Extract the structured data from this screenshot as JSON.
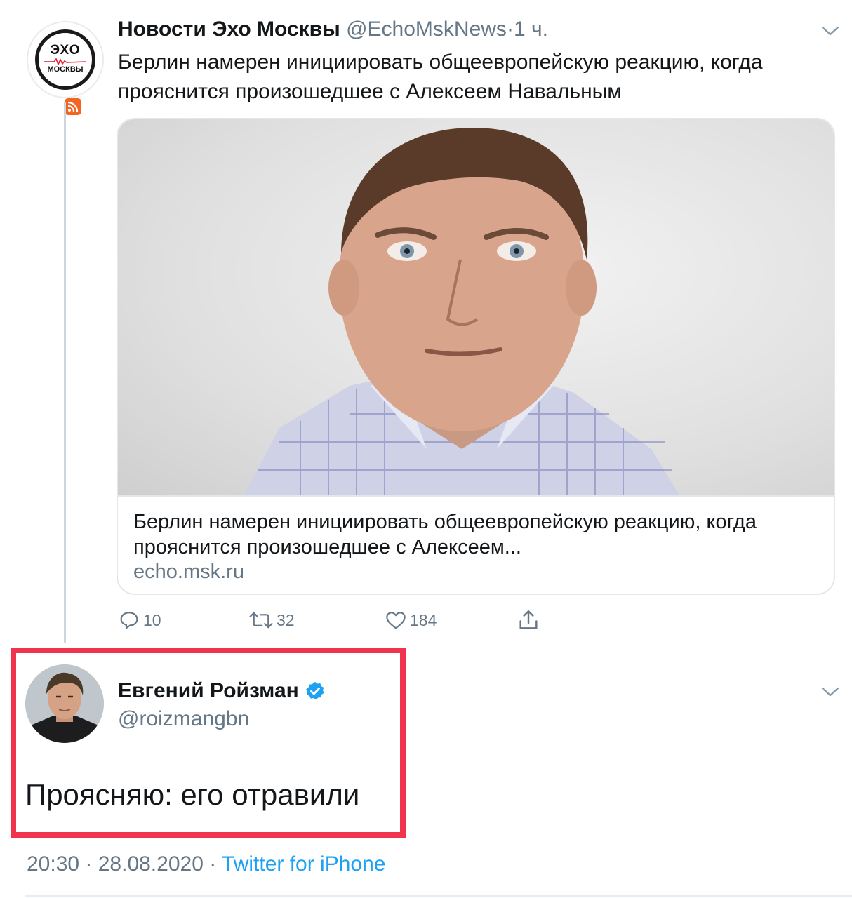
{
  "tweet": {
    "author_name": "Новости Эхо Москвы",
    "author_handle": "@EchoMskNews",
    "separator": "·",
    "time": "1 ч.",
    "text": "Берлин намерен инициировать общеевропейскую реакцию, когда прояснится произошедшее с Алексеем Навальным",
    "avatar_logo_top": "ЭХО",
    "avatar_logo_bottom": "МОСКВЫ",
    "card": {
      "title": "Берлин намерен инициировать общеевропейскую реакцию, когда прояснится произошедшее с Алексеем...",
      "domain": "echo.msk.ru"
    },
    "actions": {
      "replies": "10",
      "retweets": "32",
      "likes": "184"
    },
    "icons": [
      "chevron-down-icon",
      "reply-icon",
      "retweet-icon",
      "like-icon",
      "share-icon",
      "rss-icon"
    ]
  },
  "reply": {
    "author_name": "Евгений Ройзман",
    "author_handle": "@roizmangbn",
    "text": "Проясняю: его отравили",
    "timestamp": "20:30 · 28.08.2020",
    "separator": "·",
    "source": "Twitter for iPhone",
    "icons": [
      "verified-badge-icon",
      "chevron-down-icon"
    ]
  },
  "colors": {
    "text": "#14171a",
    "secondary": "#657786",
    "link": "#1da1f2",
    "highlight": "#f0344d",
    "verified": "#1da1f2"
  }
}
